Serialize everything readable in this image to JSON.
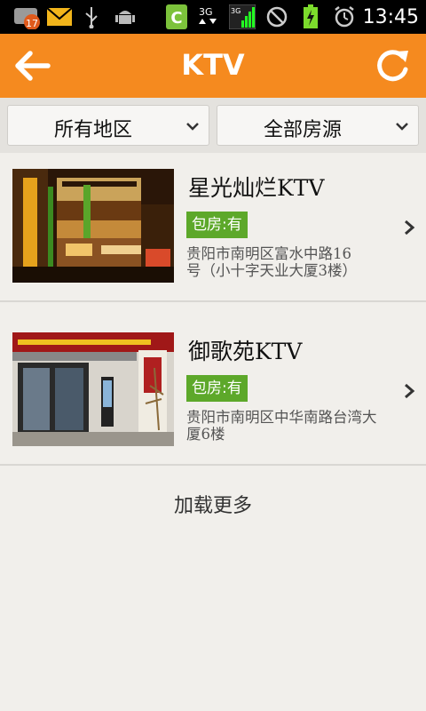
{
  "status_bar": {
    "notification_count": "17",
    "time": "13:45",
    "icons": [
      "gmail-icon",
      "mail-icon",
      "usb-icon",
      "android-icon",
      "c-app-icon",
      "3g-icon",
      "signal-icon",
      "no-sound-icon",
      "battery-icon",
      "alarm-icon"
    ]
  },
  "header": {
    "title": "KTV",
    "back_icon": "back-arrow-icon",
    "refresh_icon": "refresh-icon"
  },
  "filters": [
    {
      "label": "所有地区"
    },
    {
      "label": "全部房源"
    }
  ],
  "items": [
    {
      "name": "星光灿烂KTV",
      "badge": "包房:有",
      "address": "贵阳市南明区富水中路16号（小十字天业大厦3楼）"
    },
    {
      "name": "御歌苑KTV",
      "badge": "包房:有",
      "address": "贵阳市南明区中华南路台湾大厦6楼"
    }
  ],
  "load_more": "加载更多",
  "colors": {
    "header": "#f58a1f",
    "badge": "#5da82a",
    "background": "#f1efeb"
  }
}
